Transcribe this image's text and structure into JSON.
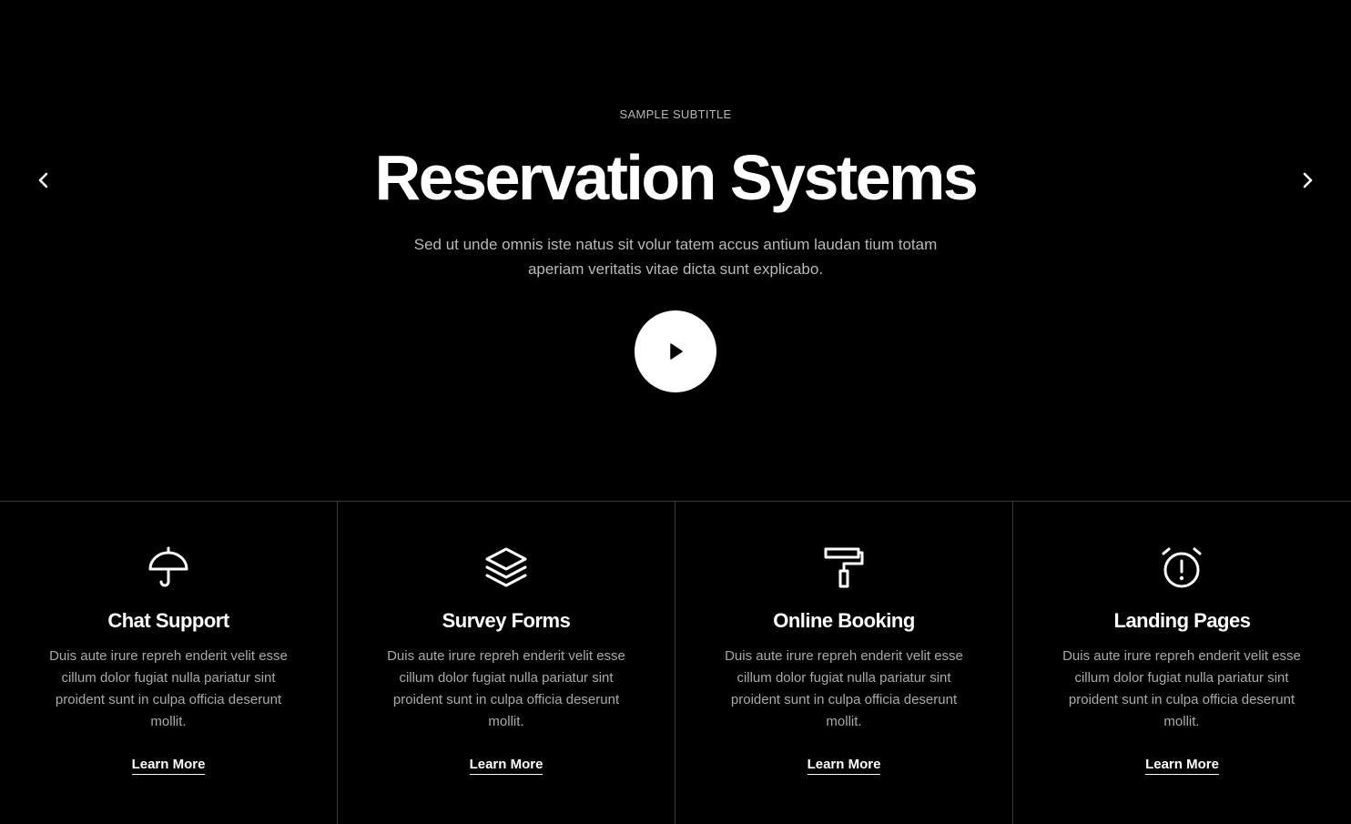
{
  "hero": {
    "subtitle": "SAMPLE SUBTITLE",
    "title": "Reservation Systems",
    "description": "Sed ut unde omnis iste natus sit volur tatem accus antium laudan tium totam aperiam veritatis vitae dicta sunt explicabo.",
    "play_icon": "play-icon",
    "prev_icon": "chevron-left-icon",
    "next_icon": "chevron-right-icon"
  },
  "features": [
    {
      "icon": "umbrella-icon",
      "title": "Chat Support",
      "text": "Duis aute irure repreh enderit velit esse cillum dolor fugiat nulla pariatur sint proident sunt in culpa officia deserunt mollit.",
      "link": "Learn More"
    },
    {
      "icon": "layers-icon",
      "title": "Survey Forms",
      "text": "Duis aute irure repreh enderit velit esse cillum dolor fugiat nulla pariatur sint proident sunt in culpa officia deserunt mollit.",
      "link": "Learn More"
    },
    {
      "icon": "paint-roller-icon",
      "title": "Online Booking",
      "text": "Duis aute irure repreh enderit velit esse cillum dolor fugiat nulla pariatur sint proident sunt in culpa officia deserunt mollit.",
      "link": "Learn More"
    },
    {
      "icon": "alarm-clock-icon",
      "title": "Landing Pages",
      "text": "Duis aute irure repreh enderit velit esse cillum dolor fugiat nulla pariatur sint proident sunt in culpa officia deserunt mollit.",
      "link": "Learn More"
    }
  ],
  "colors": {
    "background": "#000000",
    "text": "#ffffff",
    "muted": "#a9a9a9",
    "divider": "#3a3a3a"
  }
}
